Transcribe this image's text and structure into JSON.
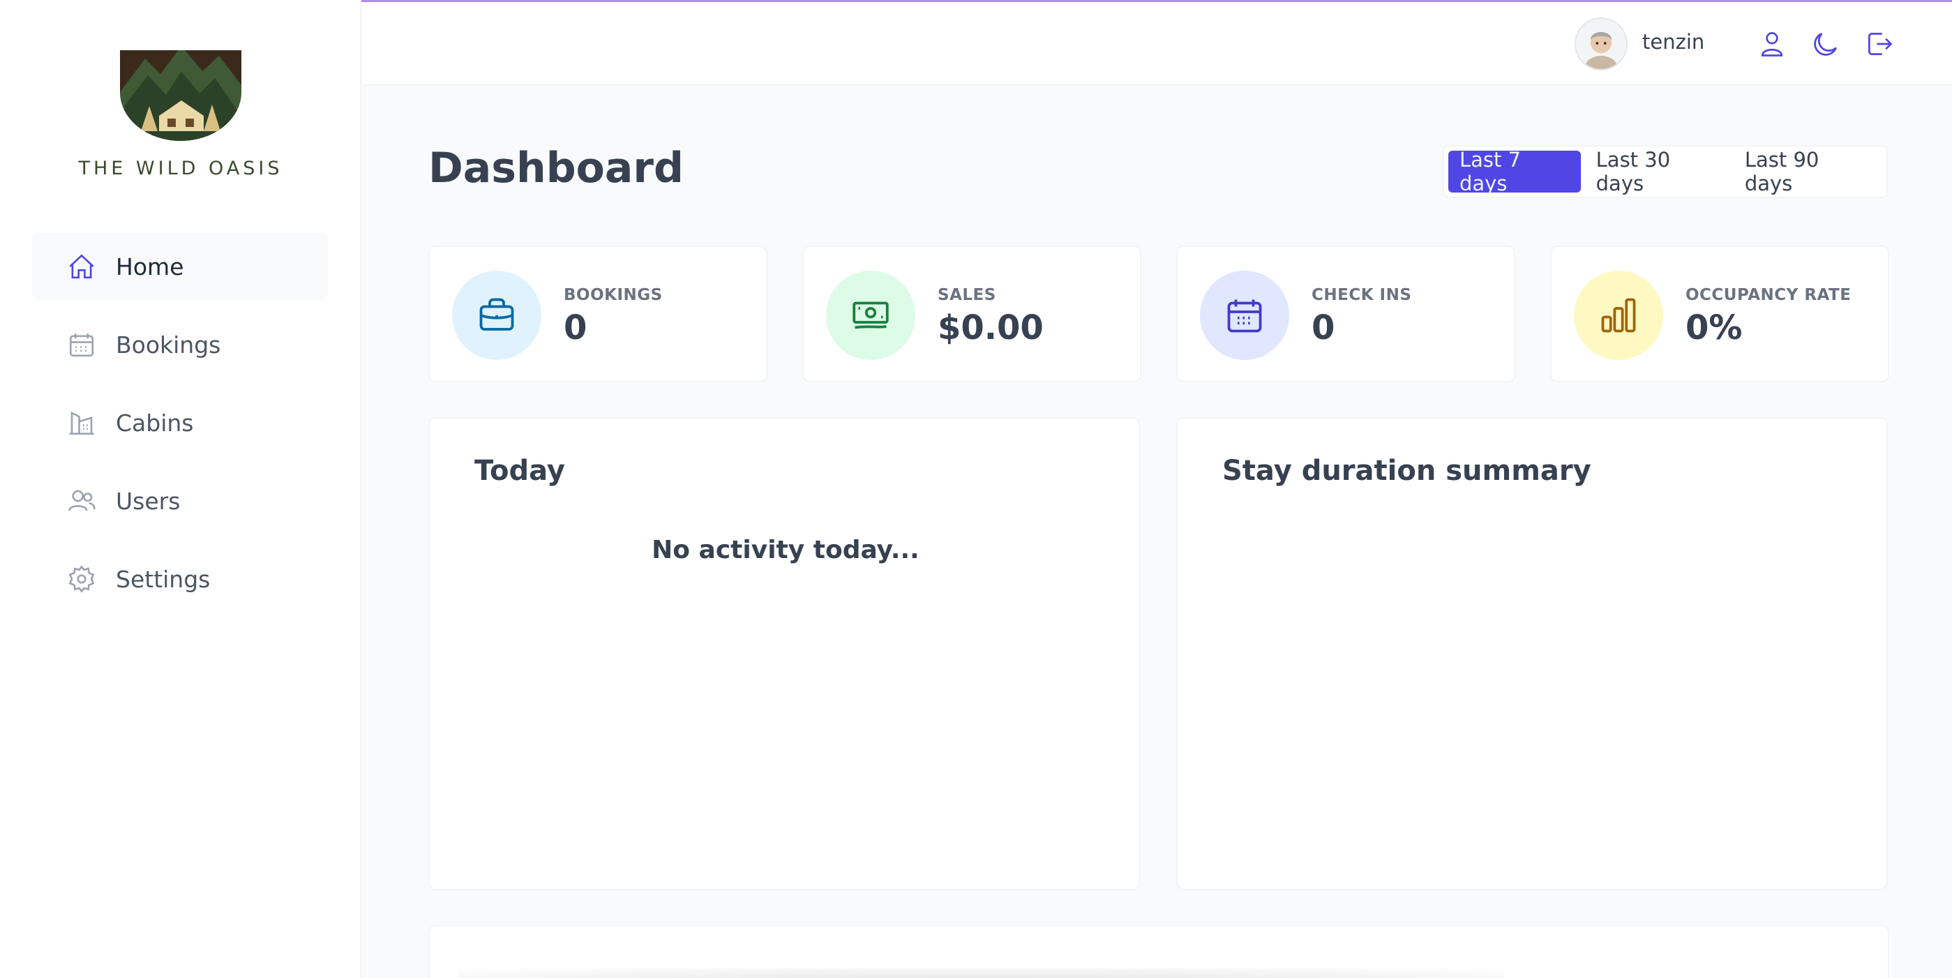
{
  "brand": {
    "name": "THE WILD OASIS"
  },
  "sidebar": {
    "items": [
      {
        "label": "Home",
        "icon": "home-icon",
        "active": true
      },
      {
        "label": "Bookings",
        "icon": "calendar-icon"
      },
      {
        "label": "Cabins",
        "icon": "cabins-icon"
      },
      {
        "label": "Users",
        "icon": "users-icon"
      },
      {
        "label": "Settings",
        "icon": "gear-icon"
      }
    ]
  },
  "header": {
    "username": "tenzin",
    "actions": [
      "user-icon",
      "moon-icon",
      "logout-icon"
    ]
  },
  "main": {
    "title": "Dashboard",
    "filters": [
      "Last 7 days",
      "Last 30 days",
      "Last 90 days"
    ],
    "active_filter": "Last 7 days",
    "stats": [
      {
        "label": "BOOKINGS",
        "value": "0",
        "icon": "briefcase-icon",
        "color": "#e0f2fe"
      },
      {
        "label": "SALES",
        "value": "$0.00",
        "icon": "banknotes-icon",
        "color": "#dcfce7"
      },
      {
        "label": "CHECK INS",
        "value": "0",
        "icon": "calendar-days-icon",
        "color": "#e0e7ff"
      },
      {
        "label": "OCCUPANCY RATE",
        "value": "0%",
        "icon": "chart-bar-icon",
        "color": "#fef9c3"
      }
    ],
    "today": {
      "title": "Today",
      "empty_text": "No activity today..."
    },
    "stay_duration": {
      "title": "Stay duration summary"
    }
  },
  "colors": {
    "accent": "#4f46e5",
    "topline": "#8b5cf6"
  }
}
